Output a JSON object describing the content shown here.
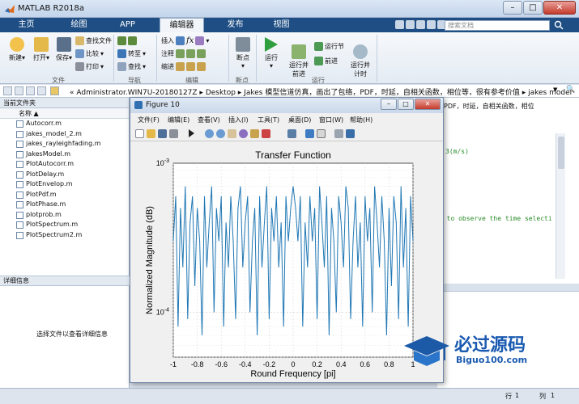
{
  "window": {
    "title": "MATLAB R2018a",
    "min": "–",
    "max": "□",
    "close": "✕"
  },
  "tabs": [
    {
      "label": "主页"
    },
    {
      "label": "绘图"
    },
    {
      "label": "APP"
    },
    {
      "label": "编辑器"
    },
    {
      "label": "发布"
    },
    {
      "label": "视图"
    }
  ],
  "search": {
    "placeholder": "搜索文档"
  },
  "ribbon": {
    "file": {
      "new": "新建",
      "open": "打开",
      "save": "保存",
      "find_files": "查找文件",
      "compare": "比较",
      "print": "打印",
      "group": "文件"
    },
    "nav": {
      "goto": "转至",
      "find": "查找",
      "group": "导航"
    },
    "edit": {
      "insert": "插入",
      "comment": "注释",
      "indent": "缩进",
      "fx": "fx",
      "group": "编辑"
    },
    "bp": {
      "breakpoint": "断点",
      "group": "断点"
    },
    "run": {
      "run": "运行",
      "run_advance": "运行并\n前进",
      "run_section": "运行节",
      "advance": "前进",
      "run_time": "运行并\n计时",
      "group": "运行"
    }
  },
  "address": {
    "path": "«  Administrator.WIN7U-20180127Z  ▸  Desktop  ▸  Jakes 模型信道仿真，画出了包络，PDF，时延，自相关函数，相位等，很有参考价值  ▸  jakes model",
    "dropdown": "▼"
  },
  "left_panel": {
    "title": "当前文件夹",
    "col_name": "名称 ▲",
    "files": [
      "Autocorr.m",
      "jakes_model_2.m",
      "jakes_rayleighfading.m",
      "JakesModel.m",
      "PlotAutocorr.m",
      "PlotDelay.m",
      "PlotEnvelop.m",
      "PlotPdf.m",
      "PlotPhase.m",
      "plotprob.m",
      "PlotSpectrum.m",
      "PlotSpectrum2.m"
    ],
    "detail_title": "详细信息",
    "detail_text": "选择文件以查看详细信息"
  },
  "editor_visible": {
    "line1": "，PDF，时延，自相关函数，相位",
    "line2": "3(m/s)",
    "line3": "t to observe the time selecti"
  },
  "status": {
    "ln_label": "行",
    "ln": "1",
    "col_label": "列",
    "col": "1"
  },
  "figure": {
    "title": "Figure 10",
    "menu": [
      "文件(F)",
      "编辑(E)",
      "查看(V)",
      "插入(I)",
      "工具(T)",
      "桌面(D)",
      "窗口(W)",
      "帮助(H)"
    ],
    "min": "–",
    "max": "□",
    "close": "✕"
  },
  "chart_data": {
    "type": "line",
    "title": "Transfer Function",
    "xlabel": "Round Frequency [pi]",
    "ylabel": "Normalized Magnitude (dB)",
    "xlim": [
      -1,
      1
    ],
    "ylim": [
      5e-05,
      0.001
    ],
    "yscale": "log",
    "xticks": [
      "-1",
      "-0.8",
      "-0.6",
      "-0.4",
      "-0.2",
      "0",
      "0.2",
      "0.4",
      "0.6",
      "0.8",
      "1"
    ],
    "yticks": [
      {
        "label": "10",
        "exp": "-3",
        "value": 0.001
      },
      {
        "label": "10",
        "exp": "-4",
        "value": 0.0001
      }
    ],
    "grid": true,
    "color": "#1f77b4",
    "series": [
      {
        "x": [
          -1,
          -0.98,
          -0.96,
          -0.94,
          -0.92,
          -0.9,
          -0.88,
          -0.86,
          -0.84,
          -0.82,
          -0.8,
          -0.78,
          -0.76,
          -0.74,
          -0.72,
          -0.7,
          -0.68,
          -0.66,
          -0.64,
          -0.62,
          -0.6,
          -0.58,
          -0.56,
          -0.54,
          -0.52,
          -0.5,
          -0.48,
          -0.46,
          -0.44,
          -0.42,
          -0.4,
          -0.38,
          -0.36,
          -0.34,
          -0.32,
          -0.3,
          -0.28,
          -0.26,
          -0.24,
          -0.22,
          -0.2,
          -0.18,
          -0.16,
          -0.14,
          -0.12,
          -0.1,
          -0.08,
          -0.06,
          -0.04,
          -0.02,
          0,
          0.02,
          0.04,
          0.06,
          0.08,
          0.1,
          0.12,
          0.14,
          0.16,
          0.18,
          0.2,
          0.22,
          0.24,
          0.26,
          0.28,
          0.3,
          0.32,
          0.34,
          0.36,
          0.38,
          0.4,
          0.42,
          0.44,
          0.46,
          0.48,
          0.5,
          0.52,
          0.54,
          0.56,
          0.58,
          0.6,
          0.62,
          0.64,
          0.66,
          0.68,
          0.7,
          0.72,
          0.74,
          0.76,
          0.78,
          0.8,
          0.82,
          0.84,
          0.86,
          0.88,
          0.9,
          0.92,
          0.94,
          0.96,
          0.98,
          1
        ],
        "y": [
          0.0003,
          0.0006,
          8e-05,
          0.0005,
          0.0002,
          0.0007,
          9e-05,
          0.0004,
          0.0006,
          0.00015,
          0.0005,
          0.0003,
          7e-05,
          0.0006,
          0.0002,
          0.0004,
          0.0007,
          0.0001,
          0.0005,
          0.0003,
          0.0006,
          8e-05,
          0.0004,
          0.0002,
          0.0006,
          0.0003,
          9e-05,
          0.0005,
          0.0007,
          0.0002,
          0.0004,
          0.0006,
          0.0001,
          0.0003,
          0.0005,
          7e-05,
          0.0006,
          0.0002,
          0.0004,
          0.0007,
          9e-05,
          0.0005,
          0.0003,
          0.0006,
          0.0002,
          0.0004,
          8e-05,
          0.0006,
          0.0003,
          0.0005,
          0.0007,
          0.0005,
          0.0003,
          0.0006,
          8e-05,
          0.0004,
          0.0002,
          0.0006,
          0.0003,
          0.0005,
          9e-05,
          0.0007,
          0.0004,
          0.0002,
          0.0006,
          7e-05,
          0.0005,
          0.0003,
          0.0001,
          0.0006,
          0.0004,
          0.0002,
          0.0007,
          0.0005,
          9e-05,
          0.0003,
          0.0006,
          0.0002,
          0.0004,
          8e-05,
          0.0006,
          0.0003,
          0.0005,
          0.0001,
          0.0007,
          0.0004,
          0.0002,
          0.0006,
          0.0003,
          7e-05,
          0.0005,
          0.00015,
          0.0006,
          0.0004,
          9e-05,
          0.0007,
          0.0002,
          0.0005,
          8e-05,
          0.0006,
          0.0003
        ]
      }
    ]
  },
  "watermark": {
    "brand": "必过源码",
    "url": "Biguo100.com"
  }
}
